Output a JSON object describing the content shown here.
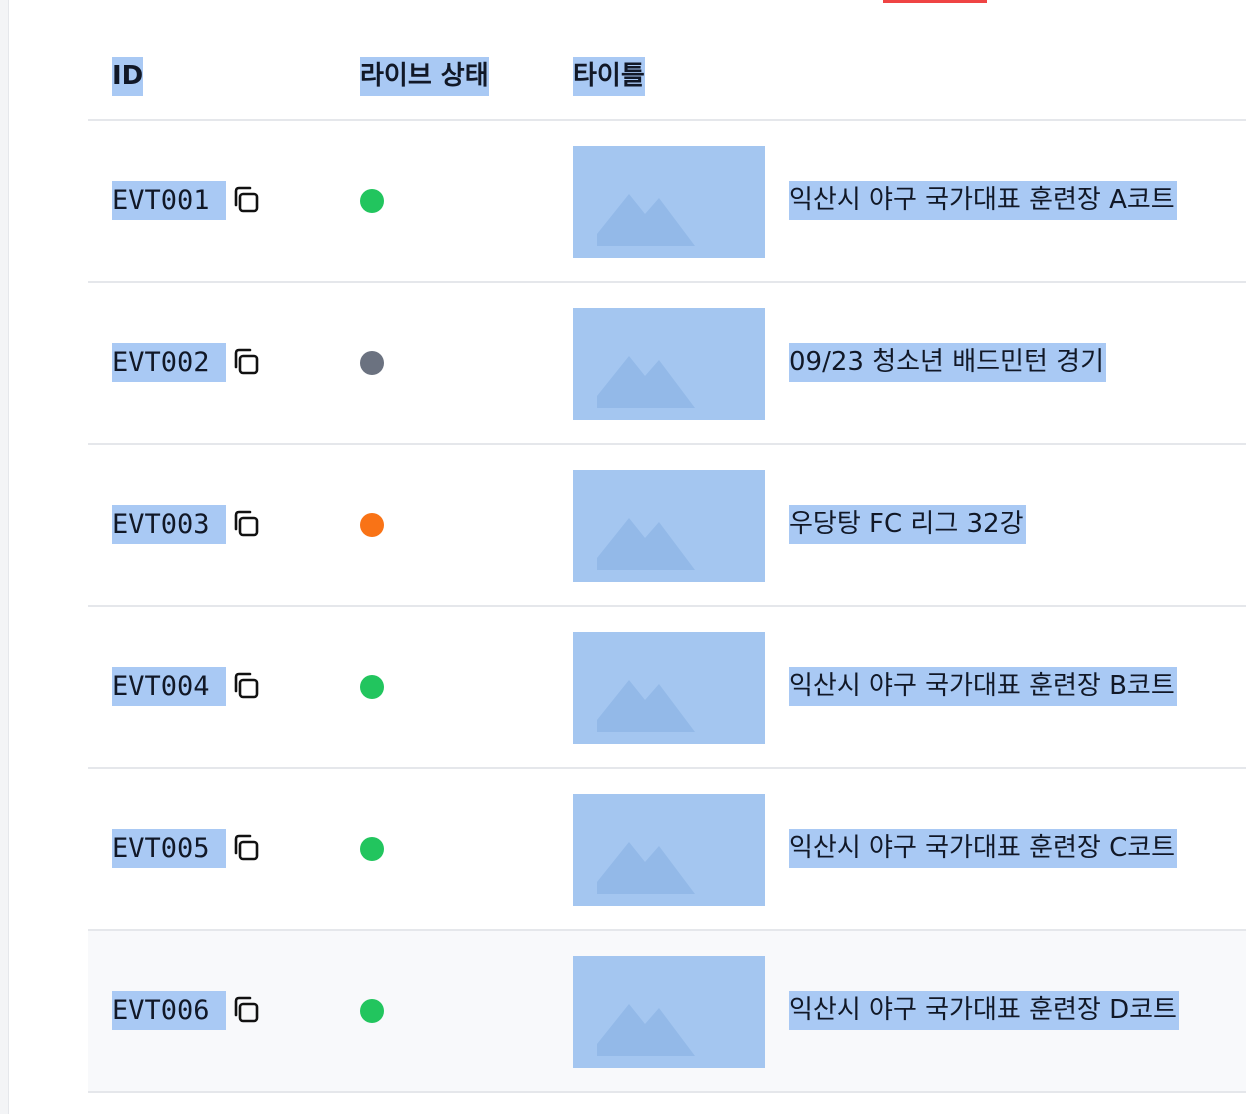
{
  "table": {
    "headers": {
      "id": "ID",
      "live_status": "라이브 상태",
      "title": "타이틀"
    },
    "rows": [
      {
        "id": "EVT001",
        "status": "live",
        "status_color": "#22c55e",
        "title": "익산시 야구 국가대표 훈련장 A코트"
      },
      {
        "id": "EVT002",
        "status": "offline",
        "status_color": "#6b7280",
        "title": "09/23 청소년 배드민턴 경기"
      },
      {
        "id": "EVT003",
        "status": "warning",
        "status_color": "#f97316",
        "title": "우당탕 FC 리그 32강"
      },
      {
        "id": "EVT004",
        "status": "live",
        "status_color": "#22c55e",
        "title": "익산시 야구 국가대표 훈련장 B코트"
      },
      {
        "id": "EVT005",
        "status": "live",
        "status_color": "#22c55e",
        "title": "익산시 야구 국가대표 훈련장 C코트"
      },
      {
        "id": "EVT006",
        "status": "live",
        "status_color": "#22c55e",
        "title": "익산시 야구 국가대표 훈련장 D코트"
      }
    ]
  },
  "icons": {
    "copy": "copy-icon",
    "thumbnail": "image-placeholder-icon"
  },
  "colors": {
    "selection_highlight": "#a9c9f4",
    "thumbnail_bg": "#a4c6f0",
    "row_divider": "#e5e7eb",
    "hover_row_bg": "#f8f9fb",
    "top_accent": "#ef4444"
  }
}
